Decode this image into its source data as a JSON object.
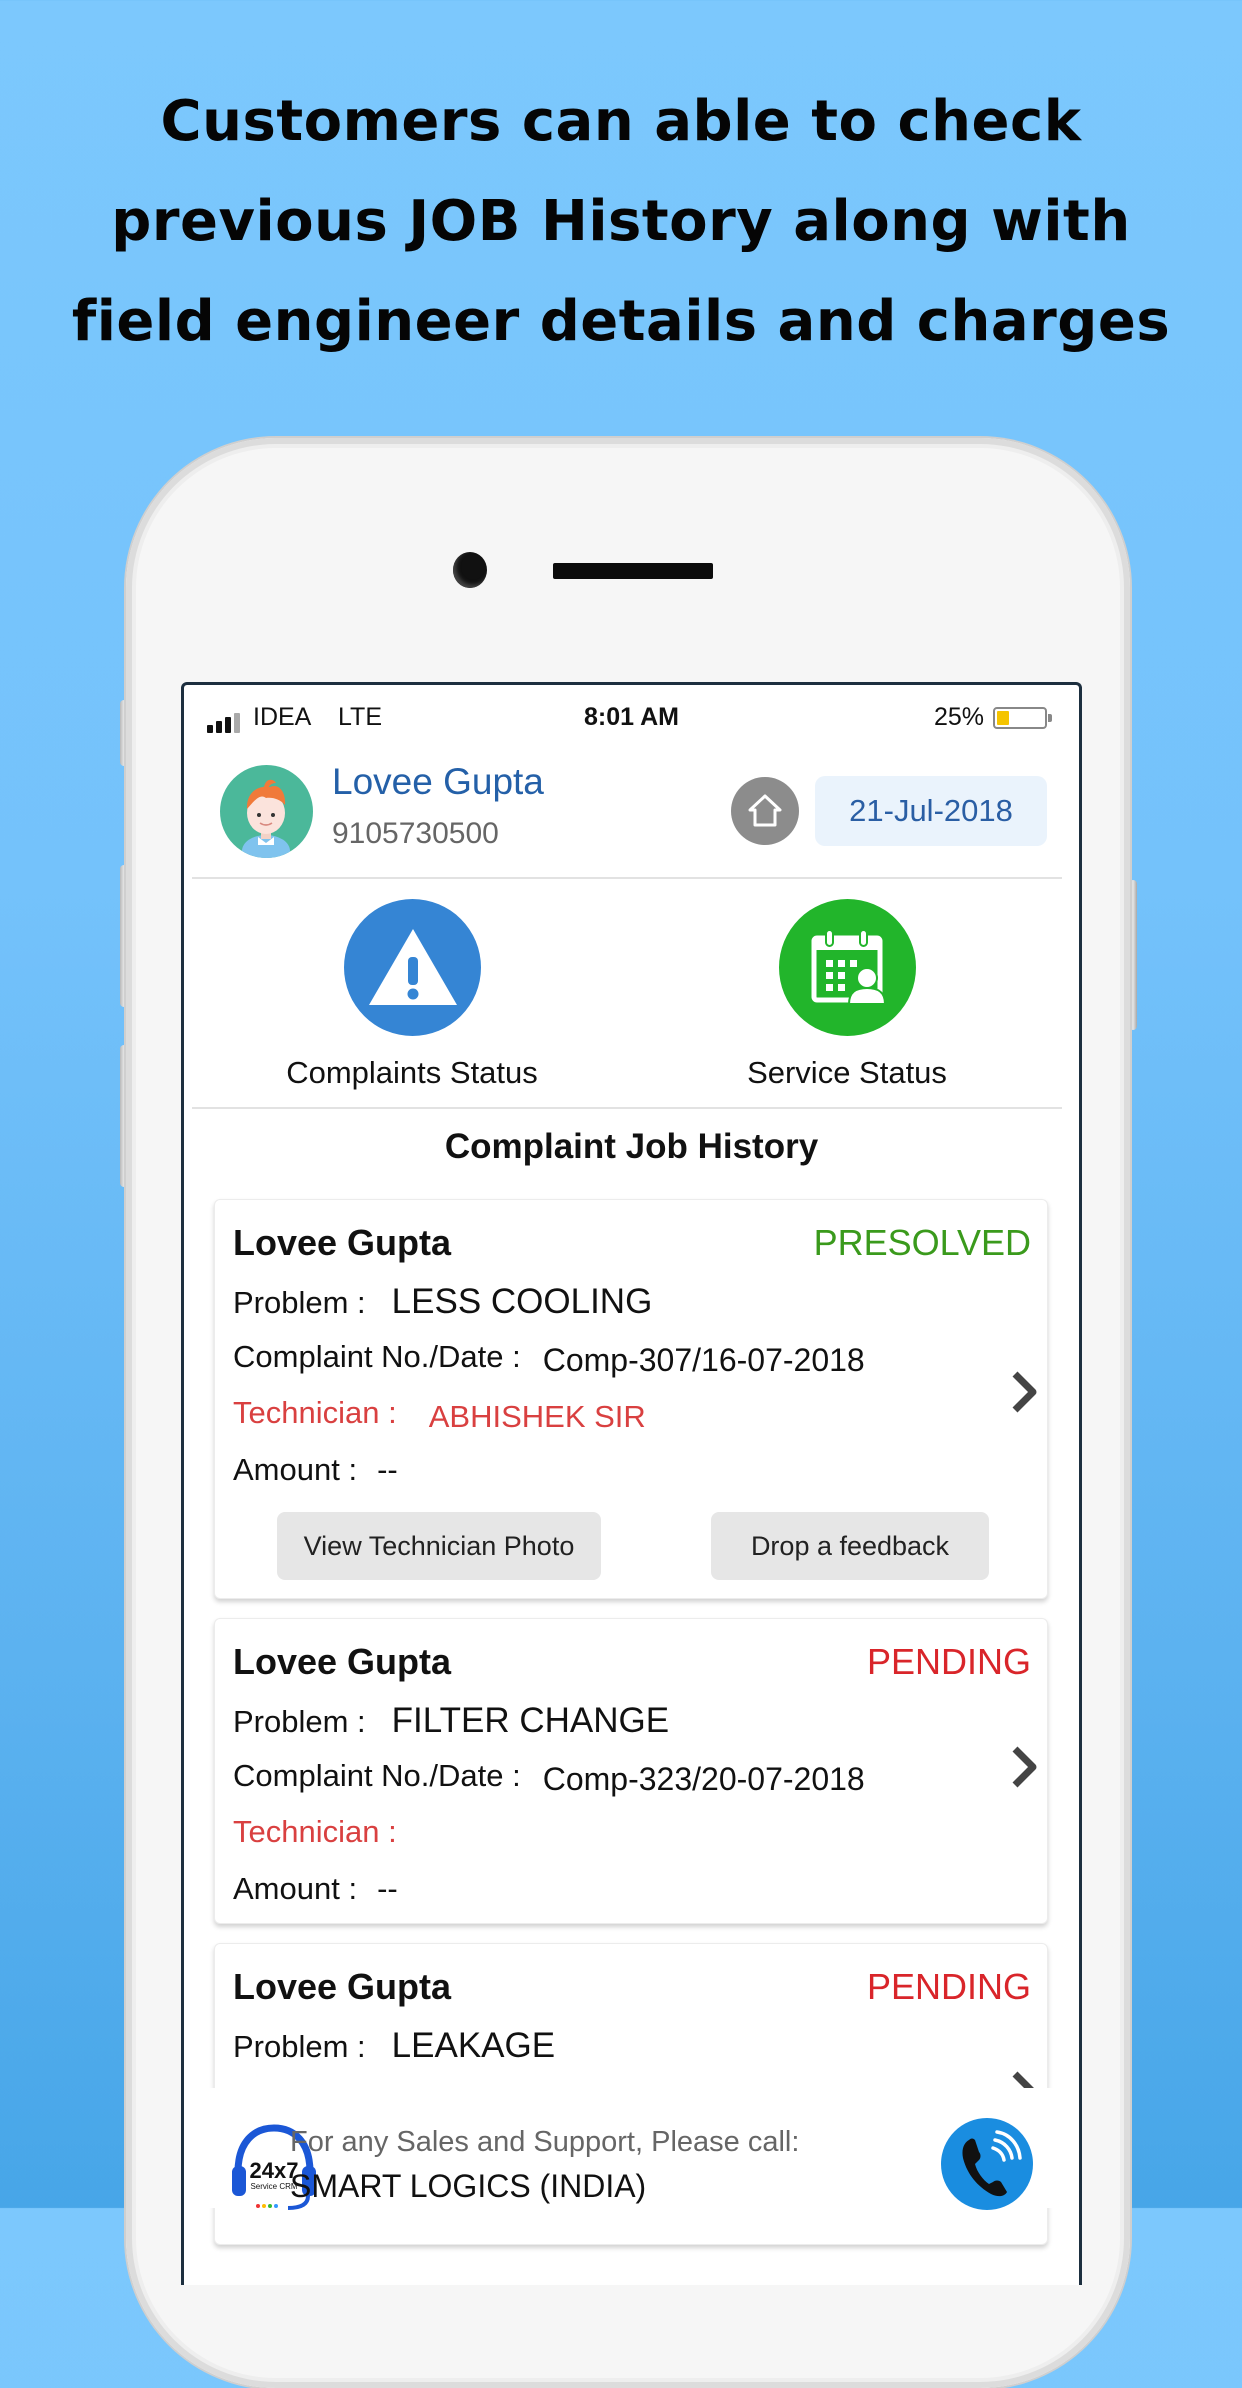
{
  "headline": {
    "lines": [
      "Customers can able to check",
      "previous JOB History along with",
      "field engineer details and charges"
    ]
  },
  "status_bar": {
    "carrier": "IDEA",
    "network": "LTE",
    "time": "8:01 AM",
    "battery_percent": "25%",
    "battery_level": 0.25,
    "signal_bars_active": 3,
    "signal_bars_total": 4
  },
  "header": {
    "user_name": "Lovee Gupta",
    "user_phone": "9105730500",
    "home_icon": "home-icon",
    "date": "21-Jul-2018"
  },
  "tiles": [
    {
      "label": "Complaints Status",
      "icon": "warning-icon",
      "color": "#3585d4"
    },
    {
      "label": "Service Status",
      "icon": "calendar-technician-icon",
      "color": "#22b52b"
    }
  ],
  "section_title": "Complaint Job History",
  "labels": {
    "problem": "Problem :",
    "complaint": "Complaint No./Date :",
    "technician": "Technician :",
    "amount": "Amount :"
  },
  "cards": [
    {
      "name": "Lovee Gupta",
      "status": "PRESOLVED",
      "status_color": "#3a9a1c",
      "problem": "LESS COOLING",
      "complaint": "Comp-307/16-07-2018",
      "technician": "ABHISHEK SIR",
      "amount": "--",
      "buttons": [
        "View Technician Photo",
        "Drop a feedback"
      ]
    },
    {
      "name": "Lovee Gupta",
      "status": "PENDING",
      "status_color": "#d9252a",
      "problem": "FILTER CHANGE",
      "complaint": "Comp-323/20-07-2018",
      "technician": "",
      "amount": "--"
    },
    {
      "name": "Lovee Gupta",
      "status": "PENDING",
      "status_color": "#d9252a",
      "problem": "LEAKAGE"
    }
  ],
  "footer": {
    "logo_text": "24x7",
    "logo_subtext": "Service CRM",
    "line1": "For any Sales and Support, Please call:",
    "line2": "SMART LOGICS (INDIA)",
    "call_icon": "phone-call-icon"
  }
}
